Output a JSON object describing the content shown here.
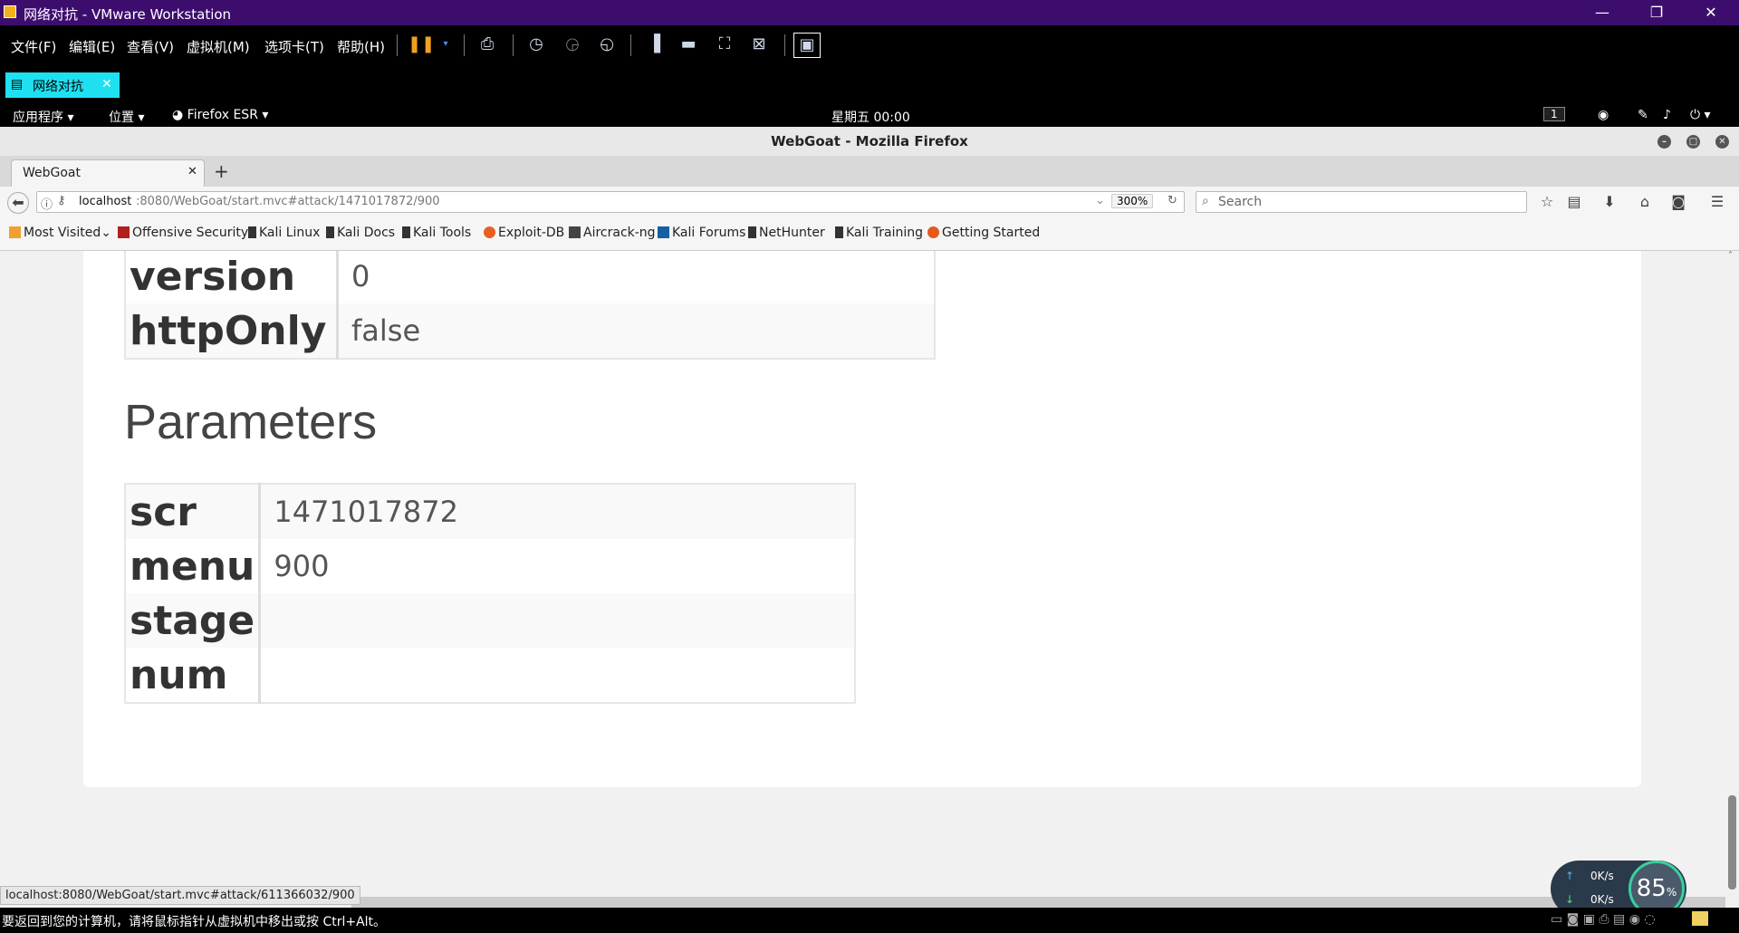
{
  "vmware": {
    "title": "网络对抗 - VMware Workstation",
    "menus": [
      "文件(F)",
      "编辑(E)",
      "查看(V)",
      "虚拟机(M)",
      "选项卡(T)",
      "帮助(H)"
    ],
    "tab_label": "网络对抗",
    "status_text": "要返回到您的计算机，请将鼠标指针从虚拟机中移出或按 Ctrl+Alt。"
  },
  "kali_panel": {
    "apps": "应用程序",
    "places": "位置",
    "firefox": "Firefox ESR",
    "clock": "星期五 00:00",
    "workspace": "1"
  },
  "firefox": {
    "window_title": "WebGoat - Mozilla Firefox",
    "tab_title": "WebGoat",
    "url_host": "localhost",
    "url_rest": ":8080/WebGoat/start.mvc#attack/1471017872/900",
    "zoom": "300%",
    "search_placeholder": "Search",
    "bookmarks": [
      "Most Visited",
      "Offensive Security",
      "Kali Linux",
      "Kali Docs",
      "Kali Tools",
      "Exploit-DB",
      "Aircrack-ng",
      "Kali Forums",
      "NetHunter",
      "Kali Training",
      "Getting Started"
    ],
    "status_url": "localhost:8080/WebGoat/start.mvc#attack/611366032/900"
  },
  "page": {
    "cookie_rows": [
      {
        "key": "version",
        "value": "0"
      },
      {
        "key": "httpOnly",
        "value": "false"
      }
    ],
    "params_heading": "Parameters",
    "param_rows": [
      {
        "key": "scr",
        "value": "1471017872"
      },
      {
        "key": "menu",
        "value": "900"
      },
      {
        "key": "stage",
        "value": ""
      },
      {
        "key": "num",
        "value": ""
      }
    ]
  },
  "network_widget": {
    "up": "0K/s",
    "down": "0K/s",
    "percent": "85"
  },
  "colors": {
    "vm_titlebar": "#3d0d6e",
    "vm_tab": "#1ee0f0"
  }
}
